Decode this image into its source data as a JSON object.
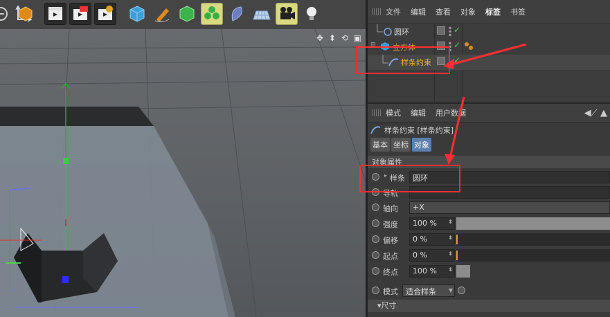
{
  "object_manager": {
    "menu": [
      "文件",
      "编辑",
      "查看",
      "对象",
      "标签",
      "书签"
    ],
    "active_menu": "标签",
    "objects": [
      {
        "name": "圆环",
        "icon": "circle-spline-icon",
        "color": "#d8d8d8"
      },
      {
        "name": "立方体",
        "icon": "cube-icon",
        "color": "#e0a030"
      },
      {
        "name": "样条约束",
        "icon": "spline-wrap-icon",
        "color": "#f0b040"
      }
    ]
  },
  "attribute_manager": {
    "menu": [
      "模式",
      "编辑",
      "用户数据"
    ],
    "object_title": "样条约束 [样条约束]",
    "tabs": [
      "基本",
      "坐标",
      "对象"
    ],
    "active_tab": "对象",
    "section_title": "对象属性",
    "params": [
      {
        "label": "样条",
        "value": "圆环",
        "type": "link"
      },
      {
        "label": "导轨",
        "value": "",
        "type": "link"
      },
      {
        "label": "轴向",
        "value": "+X",
        "type": "dropdown"
      },
      {
        "label": "强度",
        "value": "100 %",
        "type": "slider",
        "level": 1.0
      },
      {
        "label": "偏移",
        "value": "0 %",
        "type": "slider",
        "level": 0.0
      },
      {
        "label": "起点",
        "value": "0 %",
        "type": "slider",
        "level": 0.0
      },
      {
        "label": "终点",
        "value": "100 %",
        "type": "slider",
        "level": 1.0
      },
      {
        "label": "模式",
        "value": "适合样条",
        "type": "dropdown"
      }
    ],
    "footer_section": "▾尺寸"
  },
  "viewport": {
    "nav_icons": "✥ ⬍ ⟲ ▣"
  },
  "colors": {
    "annotation": "#ff2f2f",
    "highlight_tool": "#d9d982",
    "active_tab": "#5b7fae"
  }
}
